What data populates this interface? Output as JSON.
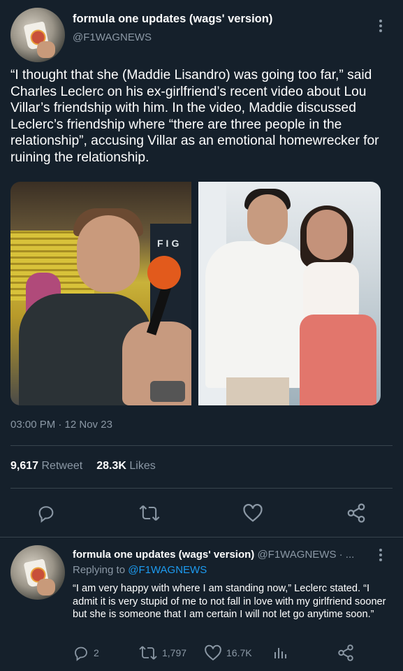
{
  "main_tweet": {
    "display_name": "formula one updates (wags' version)",
    "handle": "@F1WAGNEWS",
    "text": "“I thought that she (Maddie Lisandro) was going too far,” said Charles Leclerc on his ex-girlfriend’s recent video about Lou Villar’s friendship with him. In the video, Maddie discussed Leclerc’s friendship where “there are three people in the relationship”, accusing Villar as an emotional homewrecker for ruining the relationship.",
    "photo_sign_text": "FIG",
    "timestamp": "03:00 PM · 12 Nov 23",
    "retweet_count": "9,617",
    "retweet_label": "Retweet",
    "like_count": "28.3K",
    "like_label": "Likes"
  },
  "reply": {
    "display_name": "formula one updates (wags' version)",
    "handle_time": "@F1WAGNEWS · ...",
    "replying_label": "Replying to",
    "replying_handle": "@F1WAGNEWS",
    "text": "“I am very happy with where I am standing now,” Leclerc stated. “I admit it is very stupid of me to not fall in love with my girlfriend sooner but she is someone that I am certain I will not let go anytime soon.”",
    "reply_count": "2",
    "retweet_count": "1,797",
    "like_count": "16.7K"
  },
  "icons": {
    "reply": "reply-icon",
    "retweet": "retweet-icon",
    "like": "heart-icon",
    "share": "share-icon",
    "analytics": "analytics-icon",
    "more": "more-icon"
  },
  "colors": {
    "background": "#15202b",
    "muted": "#8b98a5",
    "accent": "#1d9bf0",
    "divider": "#38444d"
  }
}
